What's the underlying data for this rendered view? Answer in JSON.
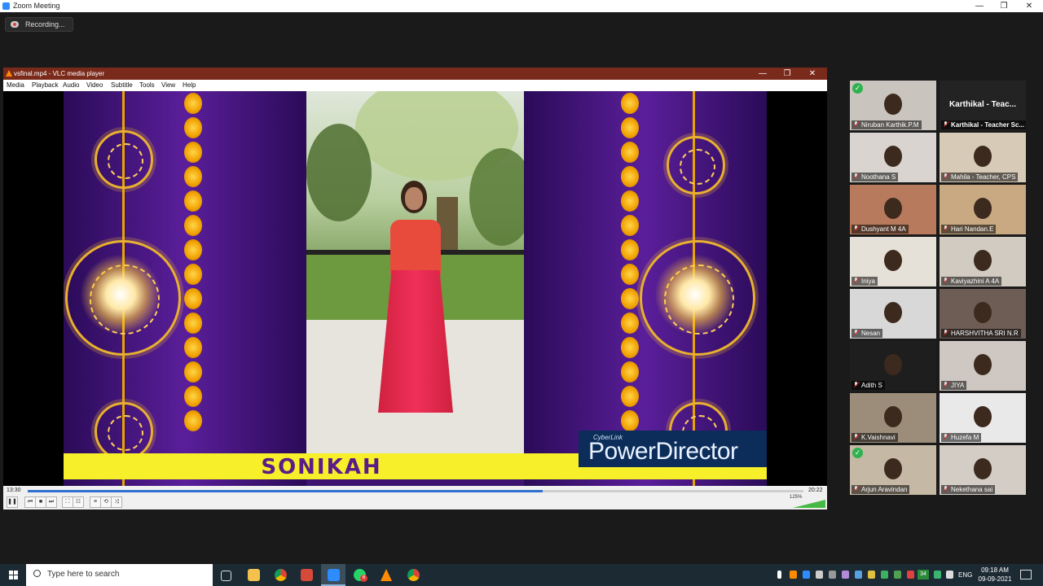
{
  "zoom": {
    "window_title": "Zoom Meeting",
    "recording_label": "Recording..."
  },
  "window_controls": {
    "minimize": "—",
    "restore": "❐",
    "close": "✕"
  },
  "vlc": {
    "window_title": "vsfinal.mp4 - VLC media player",
    "menu": [
      "Media",
      "Playback",
      "Audio",
      "Video",
      "Subtitle",
      "Tools",
      "View",
      "Help"
    ],
    "video": {
      "name_caption": "SONIKAH",
      "watermark_brand": "CyberLink",
      "watermark_product": "PowerDirector"
    },
    "time_elapsed": "13:30",
    "time_total": "20:22",
    "progress": 0.664,
    "volume_label": "125%",
    "controls": [
      "❚❚",
      "⏮",
      "■",
      "⏭",
      "⛶",
      "☷",
      "≡",
      "⟲",
      "⤨"
    ]
  },
  "participants": [
    {
      "name": "Niruban Karthik.P.M",
      "check": true,
      "bg": "#c9c4be",
      "face": true
    },
    {
      "name": "Karthikal - Teacher Sc...",
      "display_name": "Karthikal - Teac...",
      "bg": "#232323",
      "face": false
    },
    {
      "name": "Noothana S",
      "bg": "#d9d4cf",
      "face": true
    },
    {
      "name": "Mahila - Teacher, CPS",
      "active": true,
      "bg": "#d7cbb8",
      "face": true
    },
    {
      "name": "Dushyant M 4A",
      "bg": "#b87a5c",
      "face": true
    },
    {
      "name": "Hari Nandan.E",
      "bg": "#c8a982",
      "face": true
    },
    {
      "name": "Iniya",
      "bg": "#e6e1d8",
      "face": true
    },
    {
      "name": "Kaviyazhini A 4A",
      "bg": "#d2cbc2",
      "face": true
    },
    {
      "name": "Nesan",
      "bg": "#d8d8d8",
      "face": true
    },
    {
      "name": "HARSHVITHA SRI N.R",
      "bg": "#6e5d55",
      "face": true
    },
    {
      "name": "Adith S",
      "bg": "#1e1e1e",
      "face": true
    },
    {
      "name": "JIYA",
      "bg": "#cfc7c2",
      "face": true
    },
    {
      "name": "K.Vaishnavi",
      "bg": "#9b8d7a",
      "face": true
    },
    {
      "name": "Huzefa M",
      "bg": "#e9e9ea",
      "face": true
    },
    {
      "name": "Arjun Aravindan",
      "check": true,
      "bg": "#c5b8a4",
      "face": true
    },
    {
      "name": "Nekethana  sai",
      "bg": "#d3cdc5",
      "face": true
    }
  ],
  "taskbar": {
    "search_placeholder": "Type here to search",
    "language": "ENG",
    "time": "09:18 AM",
    "date": "09-09-2021",
    "app_icons": [
      "task-view-icon",
      "file-explorer-icon",
      "chrome-icon",
      "app-icon",
      "zoom-icon",
      "whatsapp-icon",
      "vlc-icon",
      "chrome-icon"
    ],
    "whatsapp_badge": "6",
    "tray_badge": "34"
  }
}
